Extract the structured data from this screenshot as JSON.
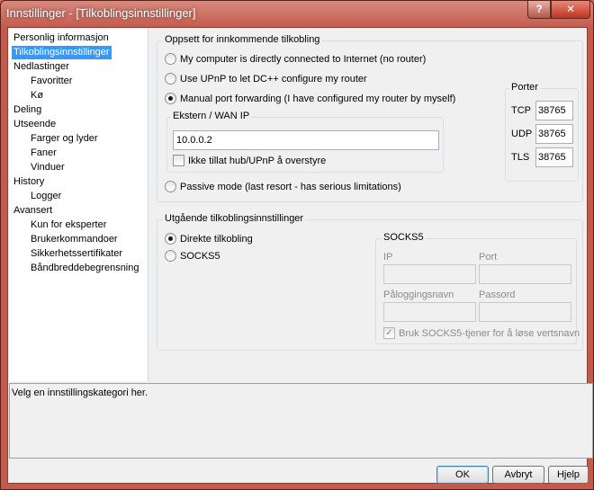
{
  "window": {
    "title": "Innstillinger - [Tilkoblingsinnstillinger]",
    "help_glyph": "?",
    "close_glyph": "✕"
  },
  "nav": {
    "items": [
      {
        "label": "Personlig informasjon"
      },
      {
        "label": "Tilkoblingsinnstillinger",
        "selected": true
      },
      {
        "label": "Nedlastinger"
      },
      {
        "label": "Favoritter"
      },
      {
        "label": "Kø"
      },
      {
        "label": "Deling"
      },
      {
        "label": "Utseende"
      },
      {
        "label": "Farger og lyder"
      },
      {
        "label": "Faner"
      },
      {
        "label": "Vinduer"
      },
      {
        "label": "History"
      },
      {
        "label": "Logger"
      },
      {
        "label": "Avansert"
      },
      {
        "label": "Kun for eksperter"
      },
      {
        "label": "Brukerkommandoer"
      },
      {
        "label": "Sikkerhetssertifikater"
      },
      {
        "label": "Båndbreddebegrensning"
      }
    ]
  },
  "incoming": {
    "title": "Oppsett for innkommende tilkobling",
    "options": [
      {
        "label": "My computer is directly connected to Internet (no router)",
        "checked": false
      },
      {
        "label": "Use UPnP to let DC++ configure my router",
        "checked": false
      },
      {
        "label": "Manual port forwarding (I have configured my router by myself)",
        "checked": true
      },
      {
        "label": "Passive mode (last resort - has serious limitations)",
        "checked": false
      }
    ],
    "wan": {
      "title": "Ekstern / WAN IP",
      "ip_value": "10.0.0.2",
      "override_label": "Ikke tillat hub/UPnP å overstyre",
      "override_checked": false
    },
    "ports": {
      "title": "Porter",
      "tcp_label": "TCP",
      "tcp_value": "38765",
      "udp_label": "UDP",
      "udp_value": "38765",
      "tls_label": "TLS",
      "tls_value": "38765"
    }
  },
  "outgoing": {
    "title": "Utgående tilkoblingsinnstillinger",
    "options": [
      {
        "label": "Direkte tilkobling",
        "checked": true
      },
      {
        "label": "SOCKS5",
        "checked": false
      }
    ],
    "socks5": {
      "title": "SOCKS5",
      "ip_label": "IP",
      "ip_value": "",
      "port_label": "Port",
      "port_value": "",
      "login_label": "Påloggingsnavn",
      "login_value": "",
      "password_label": "Passord",
      "password_value": "",
      "resolve_label": "Bruk SOCKS5-tjener for å løse vertsnavn",
      "resolve_checked": true,
      "check_glyph": "✓"
    }
  },
  "description": "Velg en innstillingskategori her.",
  "buttons": {
    "ok": "OK",
    "cancel": "Avbryt",
    "help": "Hjelp"
  }
}
